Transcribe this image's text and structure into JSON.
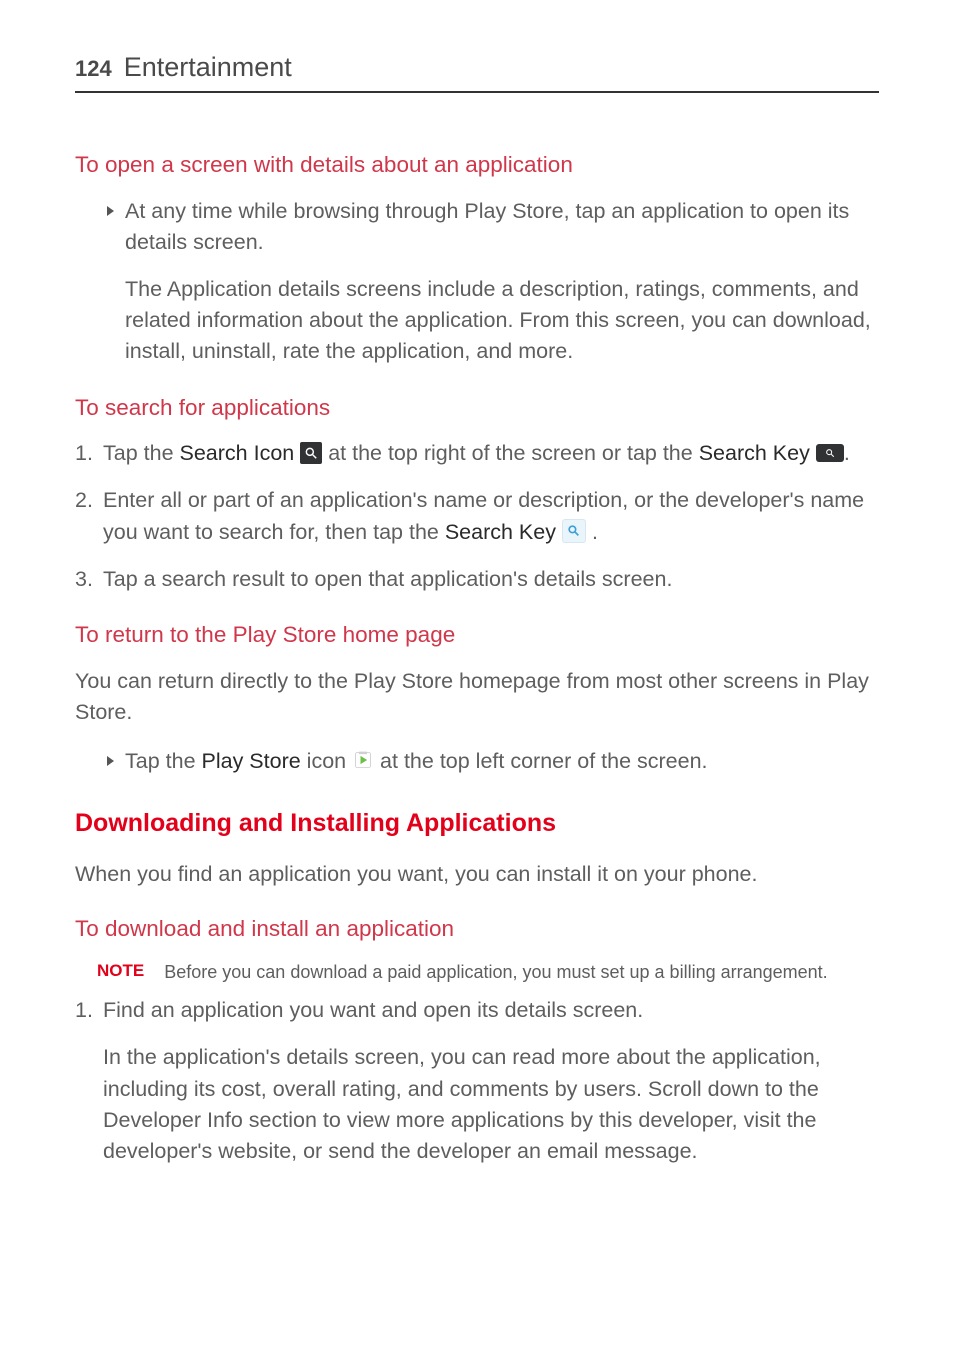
{
  "header": {
    "page_number": "124",
    "section": "Entertainment"
  },
  "h_open_details": "To open a screen with details about an application",
  "open_details_bullet": "At any time while browsing through Play Store, tap an application to open its details screen.",
  "open_details_para": "The Application details screens include a description, ratings, comments, and related information about the application. From this screen, you can download, install, uninstall, rate the application, and more.",
  "h_search": "To search for applications",
  "search_step1_a": "Tap the ",
  "search_step1_b": "Search Icon",
  "search_step1_c": " at the top right of the screen or tap the ",
  "search_step1_d": "Search Key",
  "search_step1_e": ".",
  "search_step2_a": "Enter all or part of an application's name or description, or the developer's name you want to search for, then tap the ",
  "search_step2_b": "Search Key",
  "search_step2_c": " .",
  "search_step3": "Tap a search result to open that application's details screen.",
  "h_return": "To return to the Play Store home page",
  "return_para": "You can return directly to the Play Store homepage from most other screens in Play Store.",
  "return_bullet_a": "Tap the ",
  "return_bullet_b": "Play Store",
  "return_bullet_c": " icon ",
  "return_bullet_d": " at the top left corner of the screen.",
  "h_download_install": "Downloading and Installing Applications",
  "di_intro": "When you find an application you want, you can install it on your phone.",
  "h_to_download": "To download and install an application",
  "note_label": "NOTE",
  "note_text": "Before you can download a paid application, you must set up a billing arrangement.",
  "di_step1": "Find an application you want and open its details screen.",
  "di_step1_para": "In the application's details screen, you can read more about the application, including its cost, overall rating, and comments by users. Scroll down to the Developer Info section to view more applications by this developer, visit the developer's website, or send the developer an email message.",
  "ol": {
    "n1": "1.",
    "n2": "2.",
    "n3": "3."
  }
}
